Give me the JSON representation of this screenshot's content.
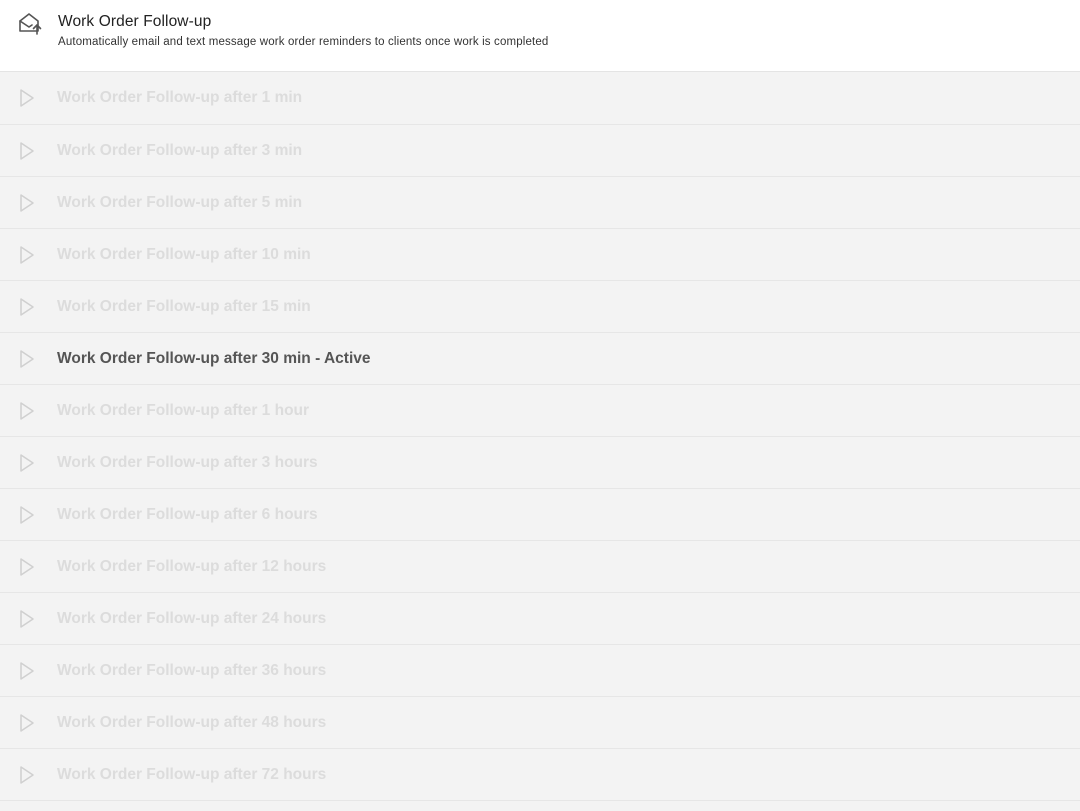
{
  "header": {
    "title": "Work Order Follow-up",
    "subtitle": "Automatically email and text message work order reminders to clients once work is completed",
    "icon": "envelope-arrow-icon"
  },
  "rows": [
    {
      "label": "Work Order Follow-up after 1 min",
      "active": false
    },
    {
      "label": "Work Order Follow-up after 3 min",
      "active": false
    },
    {
      "label": "Work Order Follow-up after 5 min",
      "active": false
    },
    {
      "label": "Work Order Follow-up after 10 min",
      "active": false
    },
    {
      "label": "Work Order Follow-up after 15 min",
      "active": false
    },
    {
      "label": "Work Order Follow-up after 30 min - Active",
      "active": true
    },
    {
      "label": "Work Order Follow-up after 1 hour",
      "active": false
    },
    {
      "label": "Work Order Follow-up after 3 hours",
      "active": false
    },
    {
      "label": "Work Order Follow-up after 6 hours",
      "active": false
    },
    {
      "label": "Work Order Follow-up after 12 hours",
      "active": false
    },
    {
      "label": "Work Order Follow-up after 24 hours",
      "active": false
    },
    {
      "label": "Work Order Follow-up after 36 hours",
      "active": false
    },
    {
      "label": "Work Order Follow-up after 48 hours",
      "active": false
    },
    {
      "label": "Work Order Follow-up after 72 hours",
      "active": false
    }
  ],
  "colors": {
    "active_text": "#555555",
    "inactive_text": "#dcdcdc",
    "list_background": "#f3f3f3",
    "play_icon": "#d0d0d0"
  }
}
